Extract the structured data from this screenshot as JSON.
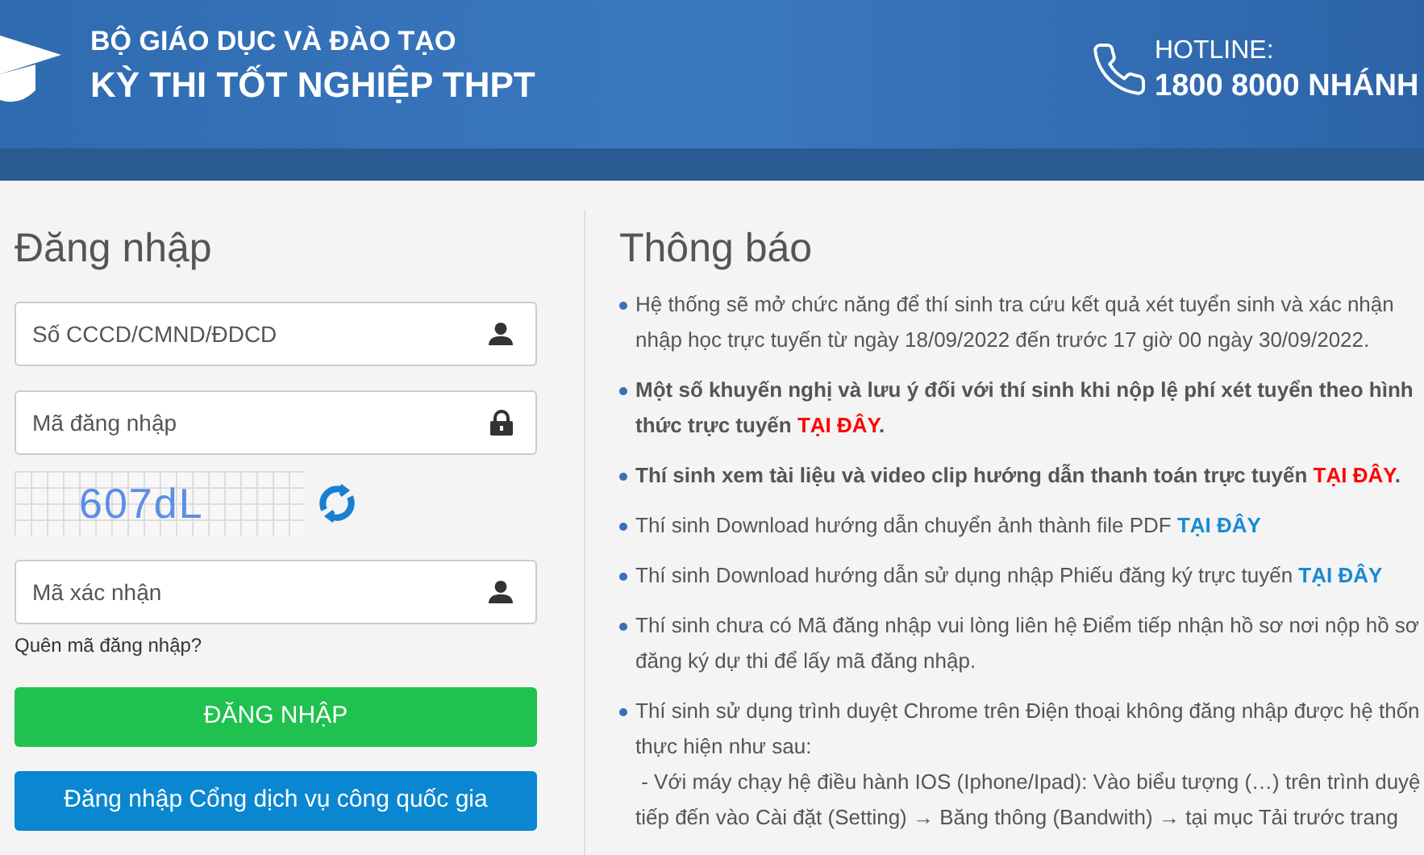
{
  "header": {
    "ministry": "BỘ GIÁO DỤC VÀ ĐÀO TẠO",
    "exam": "KỲ THI TỐT NGHIỆP THPT",
    "hotline_label": "HOTLINE:",
    "hotline_number": "1800 8000 NHÁNH"
  },
  "login": {
    "title": "Đăng nhập",
    "fields": [
      {
        "placeholder": "Số CCCD/CMND/ĐDCD",
        "kind": "user"
      },
      {
        "placeholder": "Mã đăng nhập",
        "kind": "lock"
      }
    ],
    "captcha": {
      "code": "607dL"
    },
    "captcha_field": {
      "placeholder": "Mã xác nhận",
      "kind": "user"
    },
    "forgot_link": "Quên mã đăng nhập?",
    "buttons": [
      {
        "label": "ĐĂNG NHẬP",
        "kind": "primary"
      },
      {
        "label": "Đăng nhập Cổng dịch vụ công quốc gia",
        "kind": "portal"
      }
    ]
  },
  "notices": {
    "title": "Thông báo",
    "items": [
      {
        "bold": false,
        "lines": [
          [
            {
              "text": "Hệ thống sẽ mở chức năng để thí sinh tra cứu kết quả xét tuyển sinh và xác nhận",
              "kind": "plain"
            }
          ],
          [
            {
              "text": "nhập học trực tuyến từ ngày 18/09/2022 đến trước 17 giờ 00 ngày 30/09/2022.",
              "kind": "plain"
            }
          ]
        ]
      },
      {
        "bold": true,
        "lines": [
          [
            {
              "text": "Một số khuyến nghị và lưu ý đối với thí sinh khi nộp lệ phí xét tuyển theo hình",
              "kind": "plain"
            }
          ],
          [
            {
              "text": "thức trực tuyến ",
              "kind": "plain"
            },
            {
              "text": "TẠI ĐÂY",
              "kind": "red-link"
            },
            {
              "text": ".",
              "kind": "plain"
            }
          ]
        ]
      },
      {
        "bold": true,
        "lines": [
          [
            {
              "text": "Thí sinh xem tài liệu và video clip hướng dẫn thanh toán trực tuyến ",
              "kind": "plain"
            },
            {
              "text": "TẠI ĐÂY",
              "kind": "red-link"
            },
            {
              "text": ".",
              "kind": "plain"
            }
          ]
        ]
      },
      {
        "bold": false,
        "lines": [
          [
            {
              "text": "Thí sinh Download hướng dẫn chuyển ảnh thành file PDF ",
              "kind": "plain"
            },
            {
              "text": "TẠI ĐÂY",
              "kind": "blue-link"
            }
          ]
        ]
      },
      {
        "bold": false,
        "lines": [
          [
            {
              "text": "Thí sinh Download hướng dẫn sử dụng nhập Phiếu đăng ký trực tuyến ",
              "kind": "plain"
            },
            {
              "text": "TẠI ĐÂY",
              "kind": "blue-link"
            }
          ]
        ]
      },
      {
        "bold": false,
        "lines": [
          [
            {
              "text": "Thí sinh chưa có Mã đăng nhập vui lòng liên hệ Điểm tiếp nhận hồ sơ nơi nộp hồ sơ",
              "kind": "plain"
            }
          ],
          [
            {
              "text": "đăng ký dự thi để lấy mã đăng nhập.",
              "kind": "plain"
            }
          ]
        ]
      },
      {
        "bold": false,
        "lines": [
          [
            {
              "text": "Thí sinh sử dụng trình duyệt Chrome trên Điện thoại không đăng nhập được hệ thốn",
              "kind": "plain"
            }
          ],
          [
            {
              "text": "thực hiện như sau:",
              "kind": "plain"
            }
          ],
          [
            {
              "text": " - Với máy chạy hệ điều hành IOS (Iphone/Ipad): Vào biểu tượng (…) trên trình duyệ",
              "kind": "plain"
            }
          ],
          [
            {
              "text": "tiếp đến vào Cài đặt (Setting) → Băng thông (Bandwith) → tại mục Tải trước trang",
              "kind": "plain"
            }
          ]
        ]
      }
    ]
  }
}
